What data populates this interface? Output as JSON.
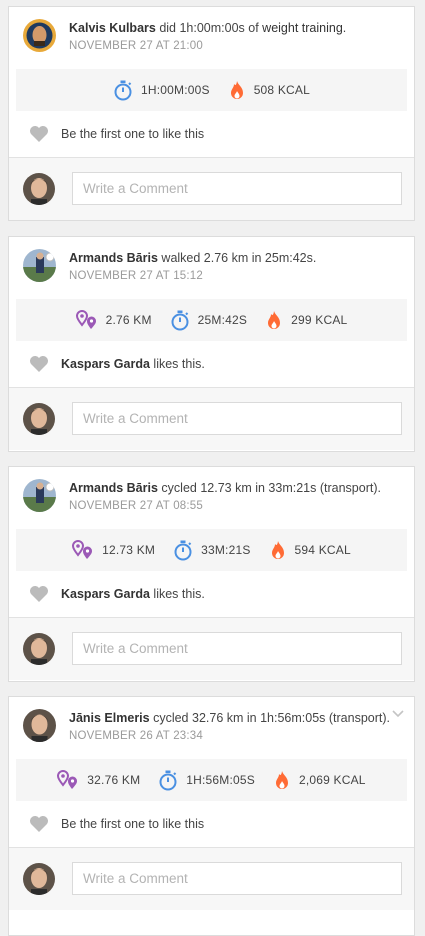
{
  "posts": [
    {
      "author": "Kalvis Kulbars",
      "verb": " did 1h:00m:00s of ",
      "activity": "weight training",
      "suffix": ".",
      "date": "NOVEMBER 27 AT 21:00",
      "stats": {
        "duration": "1H:00M:00S",
        "calories": "508 KCAL"
      },
      "likes": {
        "text": "Be the first one to like this"
      },
      "comment_placeholder": "Write a Comment"
    },
    {
      "author": "Armands Bāris",
      "verb": " walked ",
      "activity": "2.76 km in 25m:42s",
      "suffix": ".",
      "date": "NOVEMBER 27 AT 15:12",
      "stats": {
        "distance": "2.76 KM",
        "duration": "25M:42S",
        "calories": "299 KCAL"
      },
      "likes": {
        "name": "Kaspars Garda",
        "text": " likes this."
      },
      "comment_placeholder": "Write a Comment"
    },
    {
      "author": "Armands Bāris",
      "verb": " cycled ",
      "activity": "12.73 km in 33m:21s (transport)",
      "suffix": ".",
      "date": "NOVEMBER 27 AT 08:55",
      "stats": {
        "distance": "12.73 KM",
        "duration": "33M:21S",
        "calories": "594 KCAL"
      },
      "likes": {
        "name": "Kaspars Garda",
        "text": " likes this."
      },
      "comment_placeholder": "Write a Comment"
    },
    {
      "author": "Jānis Elmeris",
      "verb": " cycled ",
      "activity": "32.76 km in 1h:56m:05s (transport)",
      "suffix": ".",
      "date": "NOVEMBER 26 AT 23:34",
      "stats": {
        "distance": "32.76 KM",
        "duration": "1H:56M:05S",
        "calories": "2,069 KCAL"
      },
      "likes": {
        "text": "Be the first one to like this"
      },
      "comment_placeholder": "Write a Comment"
    }
  ],
  "icons": {
    "distance": "route-pin-icon",
    "duration": "stopwatch-icon",
    "calories": "flame-icon",
    "like": "heart-icon",
    "menu": "chevron-down-icon"
  },
  "colors": {
    "distance": "#9b59b6",
    "duration": "#4a90e2",
    "calories": "#ff6b35",
    "heart": "#bbbbbb"
  }
}
